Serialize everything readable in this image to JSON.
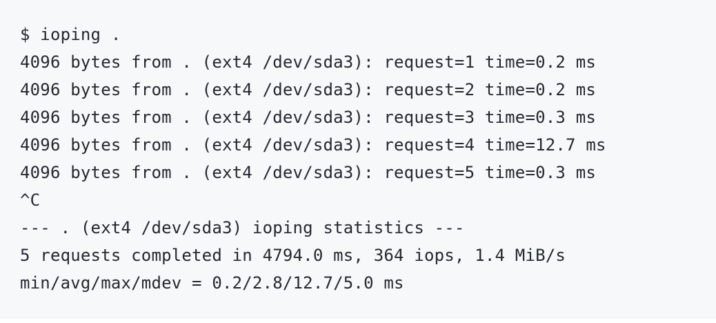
{
  "terminal": {
    "lines": [
      "$ ioping .",
      "4096 bytes from . (ext4 /dev/sda3): request=1 time=0.2 ms",
      "4096 bytes from . (ext4 /dev/sda3): request=2 time=0.2 ms",
      "4096 bytes from . (ext4 /dev/sda3): request=3 time=0.3 ms",
      "4096 bytes from . (ext4 /dev/sda3): request=4 time=12.7 ms",
      "4096 bytes from . (ext4 /dev/sda3): request=5 time=0.3 ms",
      "^C",
      "--- . (ext4 /dev/sda3) ioping statistics ---",
      "5 requests completed in 4794.0 ms, 364 iops, 1.4 MiB/s",
      "min/avg/max/mdev = 0.2/2.8/12.7/5.0 ms"
    ]
  },
  "colors": {
    "background": "#f6f8fa",
    "text": "#24292e"
  }
}
